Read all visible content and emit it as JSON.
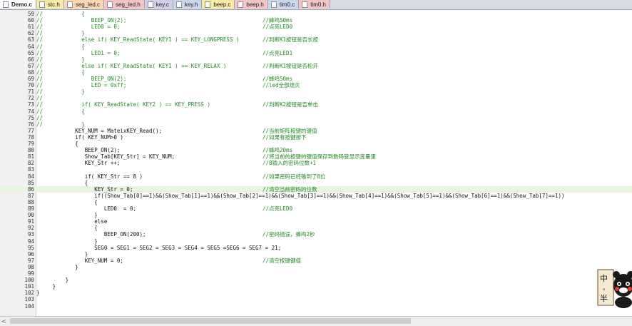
{
  "tabs": [
    {
      "label": "Demo.c",
      "active": true,
      "color": "white"
    },
    {
      "label": "stc.h",
      "color": "yellow"
    },
    {
      "label": "seg_led.c",
      "color": "orange"
    },
    {
      "label": "seg_led.h",
      "color": "pink"
    },
    {
      "label": "key.c",
      "color": "purple"
    },
    {
      "label": "key.h",
      "color": "blue"
    },
    {
      "label": "beep.c",
      "color": "yellow"
    },
    {
      "label": "beep.h",
      "color": "pink"
    },
    {
      "label": "tim0.c",
      "color": "blue"
    },
    {
      "label": "tim0.h",
      "color": "pink"
    }
  ],
  "current_line": "86",
  "lines": [
    {
      "n": "59",
      "code": "//            {",
      "comment": ""
    },
    {
      "n": "60",
      "code": "//               BEEP_ON(2);",
      "comment": "//蜂鸣50ms"
    },
    {
      "n": "61",
      "code": "//               LED0 = 0;",
      "comment": "//点亮LED0"
    },
    {
      "n": "62",
      "code": "//            }",
      "comment": ""
    },
    {
      "n": "63",
      "code": "//            else if( KEY_ReadState( KEY1 ) == KEY_LONGPRESS )",
      "comment": "//判断K1按钮是否长按"
    },
    {
      "n": "64",
      "code": "//            {",
      "comment": ""
    },
    {
      "n": "65",
      "code": "//               LED1 = 0;",
      "comment": "//点亮LED1"
    },
    {
      "n": "66",
      "code": "//            }",
      "comment": ""
    },
    {
      "n": "67",
      "code": "//            else if( KEY_ReadState( KEY1 ) == KEY_RELAX )",
      "comment": "//判断K1按钮是否松开"
    },
    {
      "n": "68",
      "code": "//            {",
      "comment": ""
    },
    {
      "n": "69",
      "code": "//               BEEP_ON(2);",
      "comment": "//蜂鸣50ms"
    },
    {
      "n": "70",
      "code": "//               LED = 0xff;",
      "comment": "//led全部熄灭"
    },
    {
      "n": "71",
      "code": "//            }",
      "comment": ""
    },
    {
      "n": "72",
      "code": "//",
      "comment": ""
    },
    {
      "n": "73",
      "code": "//            if( KEY_ReadState( KEY2 ) == KEY_PRESS )",
      "comment": "//判断K2按钮是否单击"
    },
    {
      "n": "74",
      "code": "//            {",
      "comment": ""
    },
    {
      "n": "75",
      "code": "//",
      "comment": ""
    },
    {
      "n": "76",
      "code": "//            }",
      "comment": ""
    },
    {
      "n": "77",
      "code": "            KEY_NUM = MateixKEY_Read();",
      "comment": "//当前矩阵按键的键值"
    },
    {
      "n": "78",
      "code": "            if( KEY_NUM>0 )",
      "comment": "//如果有按键按下"
    },
    {
      "n": "79",
      "code": "            {",
      "comment": ""
    },
    {
      "n": "80",
      "code": "               BEEP_ON(2);",
      "comment": "//蜂鸣20ms"
    },
    {
      "n": "81",
      "code": "               Show_Tab[KEY_Str] = KEY_NUM;",
      "comment": "//将当前的按键的键值保存到数码管显示变量里"
    },
    {
      "n": "82",
      "code": "               KEY_Str ++;",
      "comment": "//8输入的密码位数+1"
    },
    {
      "n": "83",
      "code": "",
      "comment": ""
    },
    {
      "n": "84",
      "code": "               if( KEY_Str == 8 )",
      "comment": "//如果密码已经输到了8位"
    },
    {
      "n": "85",
      "code": "               {",
      "comment": ""
    },
    {
      "n": "86",
      "code": "                  KEY_Str = 0;",
      "comment": "//清空当前密码的位数"
    },
    {
      "n": "87",
      "code": "                  if((Show_Tab[0]==1)&&(Show_Tab[1]==1)&&(Show_Tab[2]==1)&&(Show_Tab[3]==1)&&(Show_Tab[4]==1)&&(Show_Tab[5]==1)&&(Show_Tab[6]==1)&&(Show_Tab[7]==1))",
      "comment": ""
    },
    {
      "n": "88",
      "code": "                  {",
      "comment": ""
    },
    {
      "n": "89",
      "code": "                     LED0  = 0;",
      "comment": "//点亮LED0"
    },
    {
      "n": "90",
      "code": "                  }",
      "comment": ""
    },
    {
      "n": "91",
      "code": "                  else",
      "comment": ""
    },
    {
      "n": "92",
      "code": "                  {",
      "comment": ""
    },
    {
      "n": "93",
      "code": "                     BEEP_ON(200);",
      "comment": "//密码错误，蜂鸣2秒"
    },
    {
      "n": "94",
      "code": "                  }",
      "comment": ""
    },
    {
      "n": "95",
      "code": "                  SEG0 = SEG1 = SEG2 = SEG3 = SEG4 = SEG5 =SEG6 = SEG7 = 21;",
      "comment": ""
    },
    {
      "n": "96",
      "code": "               }",
      "comment": ""
    },
    {
      "n": "97",
      "code": "               KEY_NUM = 0;",
      "comment": "//清空按键键值"
    },
    {
      "n": "98",
      "code": "            }",
      "comment": ""
    },
    {
      "n": "99",
      "code": "",
      "comment": ""
    },
    {
      "n": "100",
      "code": "         }",
      "comment": ""
    },
    {
      "n": "101",
      "code": "     }",
      "comment": ""
    },
    {
      "n": "102",
      "code": "}",
      "comment": ""
    },
    {
      "n": "103",
      "code": "",
      "comment": ""
    },
    {
      "n": "104",
      "code": "",
      "comment": ""
    }
  ],
  "scrollbar": {
    "left_arrow": "<"
  },
  "sticker": {
    "char_top": "中",
    "char_mid": "。",
    "char_bottom": "半"
  }
}
